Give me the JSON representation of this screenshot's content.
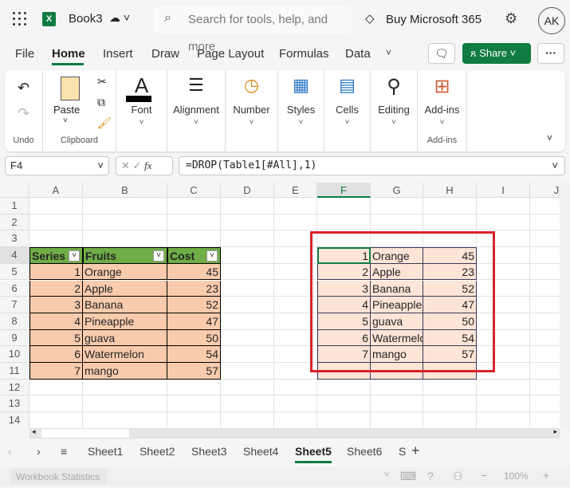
{
  "app": {
    "title": "Book3",
    "search_placeholder": "Search for tools, help, and more",
    "buy": "Buy Microsoft 365",
    "avatar": "AK",
    "share": "Share"
  },
  "menu": [
    "File",
    "Home",
    "Insert",
    "Draw",
    "Page Layout",
    "Formulas",
    "Data"
  ],
  "ribbon": {
    "undo": "Undo",
    "clipboard": "Clipboard",
    "paste": "Paste",
    "font": "Font",
    "alignment": "Alignment",
    "number": "Number",
    "styles": "Styles",
    "cells": "Cells",
    "editing": "Editing",
    "addins": "Add-ins",
    "addins_group": "Add-ins"
  },
  "formula": {
    "name_box": "F4",
    "fx": "fx",
    "value": "=DROP(Table1[#All],1)"
  },
  "columns": [
    "A",
    "B",
    "C",
    "D",
    "E",
    "F",
    "G",
    "H",
    "I",
    "J"
  ],
  "rows": [
    "1",
    "2",
    "3",
    "4",
    "5",
    "6",
    "7",
    "8",
    "9",
    "10",
    "11",
    "12",
    "13",
    "14"
  ],
  "table1": {
    "headers": [
      "Series",
      "Fruits",
      "Cost"
    ],
    "rows": [
      [
        1,
        "Orange",
        45
      ],
      [
        2,
        "Apple",
        23
      ],
      [
        3,
        "Banana",
        52
      ],
      [
        4,
        "Pineapple",
        47
      ],
      [
        5,
        "guava",
        50
      ],
      [
        6,
        "Watermelon",
        54
      ],
      [
        7,
        "mango",
        57
      ]
    ]
  },
  "result": {
    "rows": [
      [
        1,
        "Orange",
        45
      ],
      [
        2,
        "Apple",
        23
      ],
      [
        3,
        "Banana",
        52
      ],
      [
        4,
        "Pineapple",
        47
      ],
      [
        5,
        "guava",
        50
      ],
      [
        6,
        "Watermelon",
        54
      ],
      [
        7,
        "mango",
        57
      ]
    ]
  },
  "sheets": [
    "Sheet1",
    "Sheet2",
    "Sheet3",
    "Sheet4",
    "Sheet5",
    "Sheet6",
    "S"
  ],
  "active_sheet": "Sheet5",
  "status": {
    "label": "Workbook Statistics",
    "zoom": "100%"
  },
  "colors": {
    "header_green": "#70ad47",
    "table_fill": "#f8cbad",
    "result_fill": "#fce4d6",
    "highlight": "#d9222a",
    "accent": "#107c41"
  }
}
